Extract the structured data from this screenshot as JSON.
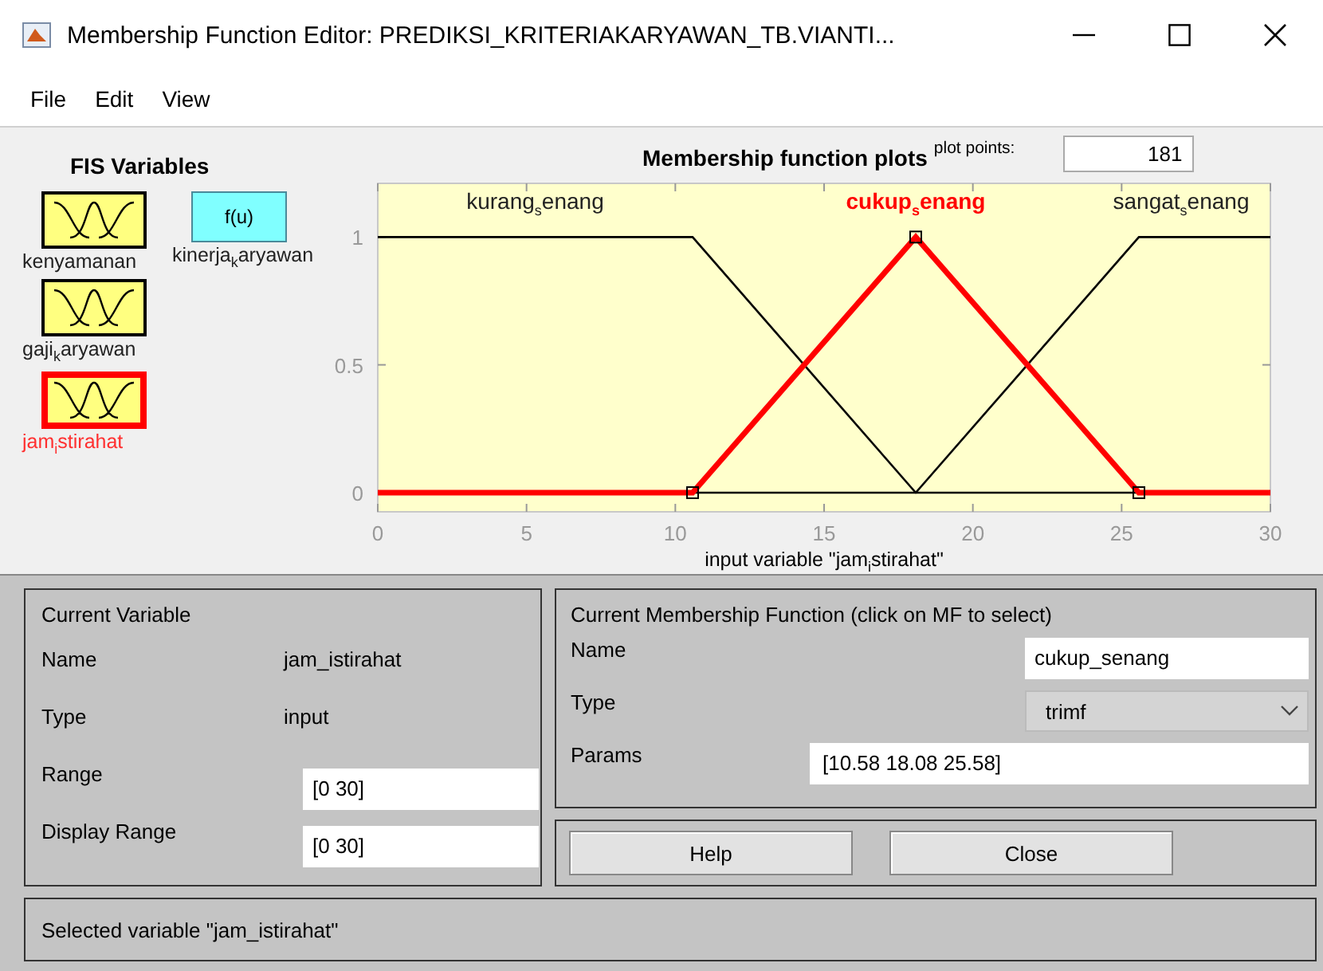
{
  "window": {
    "title": "Membership Function Editor: PREDIKSI_KRITERIAKARYAWAN_TB.VIANTI..."
  },
  "menu": [
    "File",
    "Edit",
    "View"
  ],
  "fis_variables": {
    "title": "FIS Variables",
    "items": [
      {
        "label": "kenyamanan",
        "kind": "input",
        "selected": false
      },
      {
        "label": "kinerja$_{k}$aryawan",
        "kind": "output",
        "icon_text": "f(u)",
        "selected": false
      },
      {
        "label": "gaji$_{k}$aryawan",
        "kind": "input",
        "selected": false
      },
      {
        "label": "jam$_{i}$stirahat",
        "kind": "input",
        "selected": true
      }
    ]
  },
  "plot": {
    "title": "Membership function plots",
    "plot_points_label": "plot points:",
    "plot_points": "181",
    "membership_functions": [
      {
        "selected": false
      },
      {
        "selected": true
      },
      {
        "selected": false
      }
    ],
    "chart_data": {
      "type": "line",
      "xlabel": "input variable \"jam$_{i}$stirahat\"",
      "x": [
        0,
        10.58,
        18.08,
        25.58,
        30
      ],
      "series": [
        {
          "name": "kurang$_{s}$enang",
          "color": "#000000",
          "values": [
            1,
            1,
            0,
            0,
            null
          ]
        },
        {
          "name": "cukup$_{s}$enang",
          "color": "#ff0000",
          "values": [
            0,
            0,
            1,
            0,
            0
          ]
        },
        {
          "name": "sangat$_{s}$enang",
          "color": "#000000",
          "values": [
            null,
            0,
            0,
            1,
            1
          ]
        }
      ],
      "xlim": [
        0,
        30
      ],
      "ylim": [
        -0.075,
        1.21
      ],
      "xticks": [
        0,
        5,
        10,
        15,
        20,
        25,
        30
      ],
      "yticks": [
        0,
        0.5,
        1
      ]
    }
  },
  "current_variable": {
    "title": "Current Variable",
    "fields": [
      {
        "label": "Name",
        "value": "jam_istirahat",
        "kind": "text"
      },
      {
        "label": "Type",
        "value": "input",
        "kind": "text"
      },
      {
        "label": "Range",
        "value": "[0 30]",
        "kind": "input"
      },
      {
        "label": "Display Range",
        "value": "[0 30]",
        "kind": "input"
      }
    ]
  },
  "current_mf": {
    "title": "Current Membership Function (click on MF to select)",
    "fields": [
      {
        "label": "Name",
        "value": "cukup_senang",
        "kind": "input"
      },
      {
        "label": "Type",
        "value": "trimf",
        "kind": "dropdown"
      },
      {
        "label": "Params",
        "value": "[10.58 18.08 25.58]",
        "kind": "wide-input"
      }
    ]
  },
  "buttons": [
    "Help",
    "Close"
  ],
  "status": "Selected variable \"jam_istirahat\""
}
